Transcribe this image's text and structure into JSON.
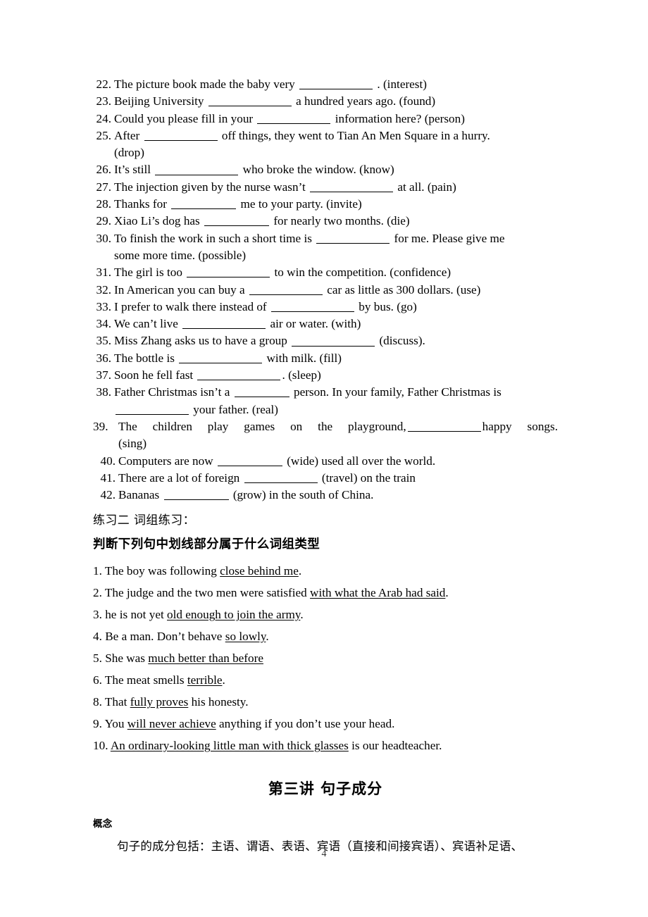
{
  "document": {
    "page_number": "4"
  },
  "fill_in_blank": {
    "items": [
      {
        "num": "22.",
        "parts": [
          {
            "t": "text",
            "v": "The picture book made the baby very "
          },
          {
            "t": "blank",
            "size": "b-lg"
          },
          {
            "t": "text",
            "v": " .   (interest)"
          }
        ]
      },
      {
        "num": "23.",
        "parts": [
          {
            "t": "text",
            "v": "Beijing University "
          },
          {
            "t": "blank",
            "size": "b-xl"
          },
          {
            "t": "text",
            "v": " a hundred years ago.   (found)"
          }
        ]
      },
      {
        "num": "24.",
        "parts": [
          {
            "t": "text",
            "v": "Could you please fill in your "
          },
          {
            "t": "blank",
            "size": "b-lg"
          },
          {
            "t": "text",
            "v": " information here?    (person)"
          }
        ]
      },
      {
        "num": "25.",
        "parts": [
          {
            "t": "text",
            "v": "After "
          },
          {
            "t": "blank",
            "size": "b-lg"
          },
          {
            "t": "text",
            "v": " off things, they went to Tian An Men Square in a hurry."
          }
        ],
        "cont": "(drop)"
      },
      {
        "num": "26.",
        "parts": [
          {
            "t": "text",
            "v": "It’s still "
          },
          {
            "t": "blank",
            "size": "b-xl"
          },
          {
            "t": "text",
            "v": " who broke the window.     (know)"
          }
        ]
      },
      {
        "num": "27.",
        "parts": [
          {
            "t": "text",
            "v": "The injection given by the nurse wasn’t "
          },
          {
            "t": "blank",
            "size": "b-xl"
          },
          {
            "t": "text",
            "v": " at all.    (pain)"
          }
        ]
      },
      {
        "num": "28.",
        "parts": [
          {
            "t": "text",
            "v": "Thanks for "
          },
          {
            "t": "blank",
            "size": "b-md"
          },
          {
            "t": "text",
            "v": " me to your party.    (invite)"
          }
        ]
      },
      {
        "num": "29.",
        "parts": [
          {
            "t": "text",
            "v": "Xiao Li’s dog has "
          },
          {
            "t": "blank",
            "size": "b-md"
          },
          {
            "t": "text",
            "v": " for nearly two months.    (die)"
          }
        ]
      },
      {
        "num": "30.",
        "parts": [
          {
            "t": "text",
            "v": "To finish the work in such a short time is "
          },
          {
            "t": "blank",
            "size": "b-lg"
          },
          {
            "t": "text",
            "v": " for me. Please give me"
          }
        ],
        "cont": "some more time. (possible)"
      },
      {
        "num": "31.",
        "parts": [
          {
            "t": "text",
            "v": "The girl is too "
          },
          {
            "t": "blank",
            "size": "b-xl"
          },
          {
            "t": "text",
            "v": " to win the competition.    (confidence)"
          }
        ]
      },
      {
        "num": "32.",
        "parts": [
          {
            "t": "text",
            "v": "In American you can buy a "
          },
          {
            "t": "blank",
            "size": "b-lg"
          },
          {
            "t": "text",
            "v": " car as little as 300 dollars. (use)"
          }
        ]
      },
      {
        "num": "33.",
        "parts": [
          {
            "t": "text",
            "v": "I prefer to walk there instead of "
          },
          {
            "t": "blank",
            "size": "b-xl"
          },
          {
            "t": "text",
            "v": " by bus.    (go)"
          }
        ]
      },
      {
        "num": "34.",
        "parts": [
          {
            "t": "text",
            "v": "We can’t live "
          },
          {
            "t": "blank",
            "size": "b-xl"
          },
          {
            "t": "text",
            "v": "  air or water.   (with)"
          }
        ]
      },
      {
        "num": "35.",
        "parts": [
          {
            "t": "text",
            "v": "Miss Zhang asks us to have a group "
          },
          {
            "t": "blank",
            "size": "b-xl"
          },
          {
            "t": "text",
            "v": " (discuss)."
          }
        ]
      },
      {
        "num": "36.",
        "parts": [
          {
            "t": "text",
            "v": "The bottle is "
          },
          {
            "t": "blank",
            "size": "b-xl"
          },
          {
            "t": "text",
            "v": " with milk.    (fill)"
          }
        ]
      },
      {
        "num": "37.",
        "parts": [
          {
            "t": "text",
            "v": "Soon he fell fast "
          },
          {
            "t": "blank",
            "size": "b-xl"
          },
          {
            "t": "text",
            "v": ". (sleep)"
          }
        ]
      },
      {
        "num": "38.",
        "parts": [
          {
            "t": "text",
            "v": "Father Christmas isn’t a "
          },
          {
            "t": "blank",
            "size": "b-sm"
          },
          {
            "t": "text",
            "v": " person. In your family, Father Christmas is"
          }
        ],
        "cont_parts": [
          {
            "t": "blank",
            "size": "b-lg"
          },
          {
            "t": "text",
            "v": " your father. (real)"
          }
        ]
      }
    ],
    "item_39": {
      "num": "39.",
      "line_1_before": "The children play games on the playground,",
      "line_1_after": "happy songs.",
      "blank_size": "b-lg",
      "cont": "(sing)"
    },
    "items_tail": [
      {
        "num": "40.",
        "parts": [
          {
            "t": "text",
            "v": "Computers are now "
          },
          {
            "t": "blank",
            "size": "b-md"
          },
          {
            "t": "text",
            "v": " (wide) used all over the world."
          }
        ]
      },
      {
        "num": "41.",
        "parts": [
          {
            "t": "text",
            "v": "There are a lot of foreign "
          },
          {
            "t": "blank",
            "size": "b-lg"
          },
          {
            "t": "text",
            "v": " (travel) on the train"
          }
        ]
      },
      {
        "num": "42.",
        "parts": [
          {
            "t": "text",
            "v": "Bananas "
          },
          {
            "t": "blank",
            "size": "b-md"
          },
          {
            "t": "text",
            "v": " (grow) in the south of China."
          }
        ]
      }
    ]
  },
  "phrase_exercise": {
    "heading_1": "练习二  词组练习：",
    "heading_2": "判断下列句中划线部分属于什么词组类型",
    "items": [
      {
        "num": "1.",
        "before": "The boy was following ",
        "underlined": "close behind me",
        "after": "."
      },
      {
        "num": "2.",
        "before": "The judge and the two men were satisfied ",
        "underlined": "with what the Arab had said",
        "after": "."
      },
      {
        "num": "3.",
        "before": "he is not yet ",
        "underlined": "old enough to join the army",
        "after": "."
      },
      {
        "num": "4.",
        "before": "Be a man. Don’t behave ",
        "underlined": "so lowly",
        "after": "."
      },
      {
        "num": "5.",
        "before": "She was ",
        "underlined": "much better than before",
        "after": ""
      },
      {
        "num": "6.",
        "before": "The meat smells ",
        "underlined": "terrible",
        "after": "."
      },
      {
        "num": "8.",
        "before": "That ",
        "underlined": "fully proves",
        "after": " his honesty."
      },
      {
        "num": "9.",
        "before": "You ",
        "underlined": "will never achieve",
        "after": " anything if you don’t use your head."
      },
      {
        "num": "10.",
        "before": "",
        "underlined": "An ordinary-looking little man with thick glasses",
        "after": " is our headteacher."
      }
    ]
  },
  "lecture": {
    "title": "第三讲 句子成分",
    "concept_label": "概念",
    "concept_body": "句子的成分包括：主语、谓语、表语、宾语（直接和间接宾语）、宾语补足语、"
  }
}
